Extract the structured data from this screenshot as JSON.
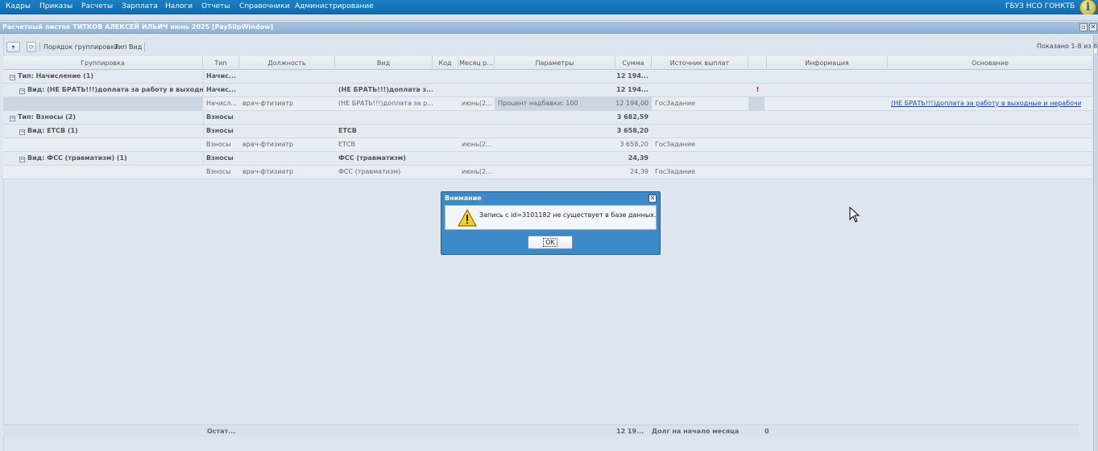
{
  "menu": {
    "items": [
      "Кадры",
      "Приказы",
      "Расчеты",
      "Зарплата",
      "Налоги",
      "Отчеты",
      "Справочники",
      "Администрирование"
    ],
    "org_name": "ГБУЗ НСО ГОНКТБ",
    "info_icon": "i"
  },
  "window": {
    "title": "Расчетный листок ТИТКОВ АЛЕКСЕЙ ИЛЬИЧ июнь 2025 [PaySlipWindow]"
  },
  "toolbar": {
    "grouping_label": "Порядок группировки:",
    "grouping_fields": [
      "Тип",
      "Вид"
    ],
    "count_text": "Показано 1-8 из 8"
  },
  "grid": {
    "columns": [
      "Группировка",
      "Тип",
      "Должность",
      "Вид",
      "Код",
      "Месяц р...",
      "Параметры",
      "Сумма",
      "Источник выплат",
      "",
      "Информация",
      "Основание"
    ],
    "rows": [
      {
        "kind": "group1",
        "group": "Тип: Начисление (1)",
        "type": "Начис...",
        "position": "",
        "vid": "",
        "code": "",
        "month": "",
        "params": "",
        "sum": "12 194...",
        "source": "",
        "flag": "",
        "info": "",
        "basis": ""
      },
      {
        "kind": "group2",
        "group": "Вид: (НЕ БРАТЬ!!!)доплата за работу в выходны...",
        "type": "Начис...",
        "position": "",
        "vid": "(НЕ БРАТЬ!!!)доплата з...",
        "code": "",
        "month": "",
        "params": "",
        "sum": "12 194...",
        "source": "",
        "flag": "!",
        "info": "",
        "basis": ""
      },
      {
        "kind": "data",
        "group": "",
        "type": "Начисл...",
        "position": "врач-фтизиатр",
        "vid": "(НЕ БРАТЬ!!!)доплата за р...",
        "code": "",
        "month": "июнь(2...",
        "params": "Процент надбавки: 100",
        "sum": "12 194,00",
        "source": "ГосЗадание",
        "flag": "",
        "info": "",
        "basis": "(НЕ БРАТЬ!!!)доплата за работу в выходные и нерабочие п..."
      },
      {
        "kind": "group1",
        "group": "Тип: Взносы (2)",
        "type": "Взносы",
        "position": "",
        "vid": "",
        "code": "",
        "month": "",
        "params": "",
        "sum": "3 682,59",
        "source": "",
        "flag": "",
        "info": "",
        "basis": ""
      },
      {
        "kind": "group2",
        "group": "Вид: ЕТСВ (1)",
        "type": "Взносы",
        "position": "",
        "vid": "ЕТСВ",
        "code": "",
        "month": "",
        "params": "",
        "sum": "3 658,20",
        "source": "",
        "flag": "",
        "info": "",
        "basis": ""
      },
      {
        "kind": "data",
        "group": "",
        "type": "Взносы",
        "position": "врач-фтизиатр",
        "vid": "ЕТСВ",
        "code": "",
        "month": "июнь(2...",
        "params": "",
        "sum": "3 658,20",
        "source": "ГосЗадание",
        "flag": "",
        "info": "",
        "basis": ""
      },
      {
        "kind": "group2",
        "group": "Вид: ФСС (травматизм) (1)",
        "type": "Взносы",
        "position": "",
        "vid": "ФСС (травматизм)",
        "code": "",
        "month": "",
        "params": "",
        "sum": "24,39",
        "source": "",
        "flag": "",
        "info": "",
        "basis": ""
      },
      {
        "kind": "data",
        "group": "",
        "type": "Взносы",
        "position": "врач-фтизиатр",
        "vid": "ФСС (травматизм)",
        "code": "",
        "month": "июнь(2...",
        "params": "",
        "sum": "24,39",
        "source": "ГосЗадание",
        "flag": "",
        "info": "",
        "basis": ""
      }
    ]
  },
  "summary": {
    "label": "Остат...",
    "sum": "12 19...",
    "debt_label": "Долг на начало месяца",
    "debt_value": "0"
  },
  "dialog": {
    "title": "Внимание",
    "message": "Запись с id=3101182 не существует в базе данных.",
    "ok_label": "OK",
    "close_glyph": "✕"
  },
  "colors": {
    "menu_bar": "#1178be",
    "dialog": "#3d88c7",
    "link": "#2244cc",
    "warn_mark": "#d01010"
  }
}
